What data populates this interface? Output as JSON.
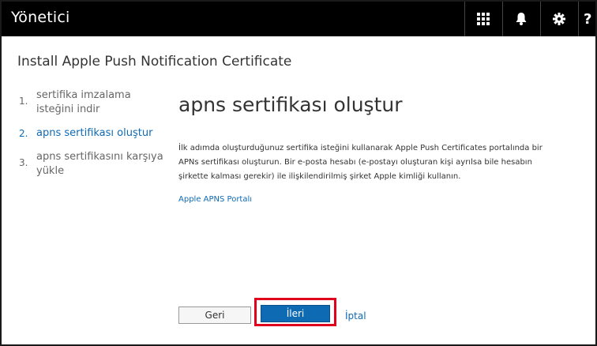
{
  "app": {
    "title": "Yönetici"
  },
  "topbar": {
    "icons": [
      "grid-icon",
      "bell-icon",
      "gear-icon",
      "help-icon"
    ],
    "help_label": "?"
  },
  "page": {
    "title": "Install Apple Push Notification Certificate"
  },
  "steps": [
    {
      "num": "1.",
      "label": "sertifika imzalama isteğini indir"
    },
    {
      "num": "2.",
      "label": "apns sertifikası oluştur"
    },
    {
      "num": "3.",
      "label": "apns sertifikasını karşıya yükle"
    }
  ],
  "main": {
    "heading": "apns sertifikası oluştur",
    "description": "İlk adımda oluşturduğunuz sertifika isteğini kullanarak Apple Push Certificates portalında bir APNs sertifikası oluşturun. Bir e-posta hesabı (e-postayı oluşturan kişi ayrılsa bile hesabın şirkette kalması gerekir) ile ilişkilendirilmiş şirket Apple kimliği kullanın.",
    "portal_link": "Apple APNS Portalı"
  },
  "footer": {
    "back_label": "Geri",
    "next_label": "İleri",
    "cancel_label": "İptal"
  },
  "colors": {
    "accent": "#0f6ab4",
    "topbar": "#000000",
    "highlight": "#e0001b"
  }
}
